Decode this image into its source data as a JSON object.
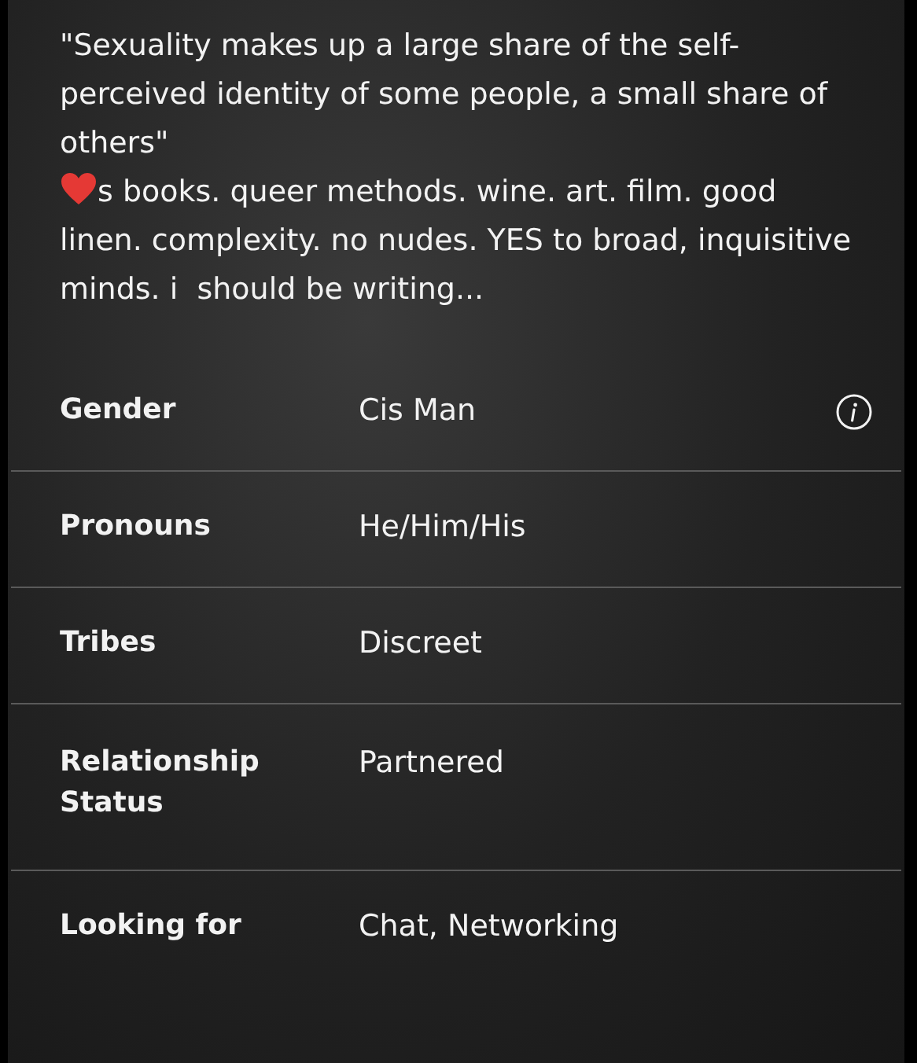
{
  "bio": {
    "quote": "\"Sexuality makes up a large share of the self-perceived identity of some people, a small share of others\"",
    "about": "s books. queer methods. wine. art. film. good linen. complexity. no nudes. YES to broad, inquisitive minds. i  should be writing..."
  },
  "details": [
    {
      "label": "Gender",
      "value": "Cis Man",
      "info": true
    },
    {
      "label": "Pronouns",
      "value": "He/Him/His",
      "info": false
    },
    {
      "label": "Tribes",
      "value": "Discreet",
      "info": false
    },
    {
      "label": "Relationship Status",
      "value": "Partnered",
      "info": false
    },
    {
      "label": "Looking for",
      "value": "Chat, Networking",
      "info": false
    }
  ]
}
